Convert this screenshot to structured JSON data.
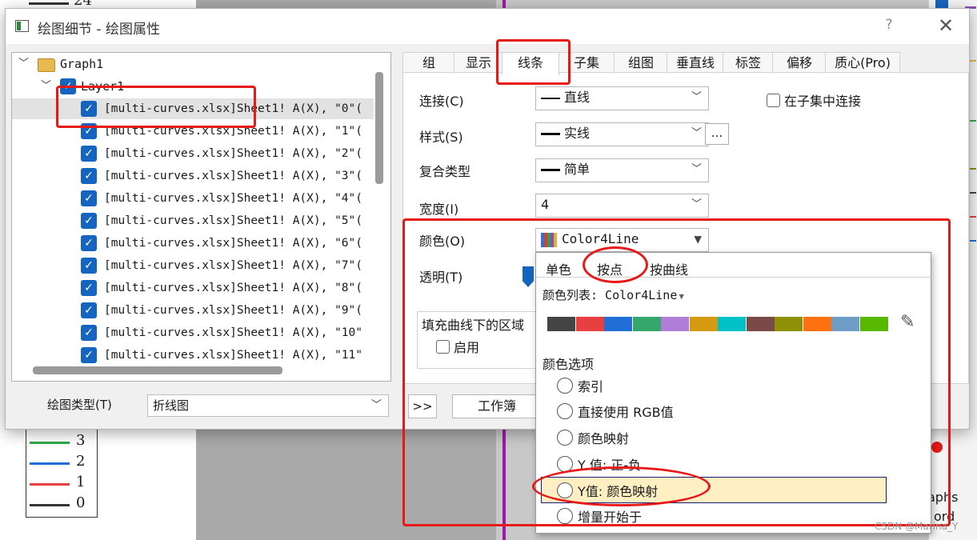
{
  "dialog": {
    "title": "绘图细节 - 绘图属性",
    "help": "?",
    "close": "✕"
  },
  "tree": {
    "graph": "Graph1",
    "layer": "Layer1",
    "items": [
      "[multi-curves.xlsx]Sheet1! A(X), \"0\"(",
      "[multi-curves.xlsx]Sheet1! A(X), \"1\"(",
      "[multi-curves.xlsx]Sheet1! A(X), \"2\"(",
      "[multi-curves.xlsx]Sheet1! A(X), \"3\"(",
      "[multi-curves.xlsx]Sheet1! A(X), \"4\"(",
      "[multi-curves.xlsx]Sheet1! A(X), \"5\"(",
      "[multi-curves.xlsx]Sheet1! A(X), \"6\"(",
      "[multi-curves.xlsx]Sheet1! A(X), \"7\"(",
      "[multi-curves.xlsx]Sheet1! A(X), \"8\"(",
      "[multi-curves.xlsx]Sheet1! A(X), \"9\"(",
      "[multi-curves.xlsx]Sheet1! A(X), \"10\"",
      "[multi-curves.xlsx]Sheet1! A(X), \"11\""
    ]
  },
  "plot_type": {
    "label": "绘图类型(T)",
    "value": "折线图"
  },
  "tabs": [
    "组",
    "显示",
    "线条",
    "子集",
    "组图",
    "垂直线",
    "标签",
    "偏移",
    "质心(Pro)"
  ],
  "form": {
    "connect_label": "连接(C)",
    "connect_value": "直线",
    "subset_connect": "在子集中连接",
    "style_label": "样式(S)",
    "style_value": "实线",
    "more": "...",
    "compound_label": "复合类型",
    "compound_value": "简单",
    "width_label": "宽度(I)",
    "width_value": "4",
    "color_label": "颜色(O)",
    "color_value": "Color4Line",
    "transparency_label": "透明(T)",
    "fill_group": "填充曲线下的区域",
    "fill_enable": "启用"
  },
  "buttons": {
    "arrows": ">>",
    "workbook": "工作簿"
  },
  "popup": {
    "tabs": [
      "单色",
      "按点",
      "按曲线"
    ],
    "list_label": "颜色列表: Color4Line",
    "swatches": [
      "#444444",
      "#e84040",
      "#1f6fd6",
      "#34a86a",
      "#b07ed6",
      "#d49a10",
      "#00c0c8",
      "#7a4a48",
      "#8e9006",
      "#ff7010",
      "#6e9ec8",
      "#58b800"
    ],
    "options_label": "颜色选项",
    "options": [
      "索引",
      "直接使用 RGB值",
      "颜色映射",
      "Y 值: 正-负",
      "Y值: 颜色映射",
      "增量开始于"
    ]
  },
  "legend": [
    {
      "label": "3",
      "color": "#2ea84a"
    },
    {
      "label": "2",
      "color": "#1f6fd6"
    },
    {
      "label": "1",
      "color": "#e84040"
    },
    {
      "label": "0",
      "color": "#333333"
    }
  ],
  "background": {
    "fragment_top": "24",
    "fragment_right1": "aphs",
    "fragment_right2": "ord"
  },
  "watermark": "CSDN @Marina_Y"
}
